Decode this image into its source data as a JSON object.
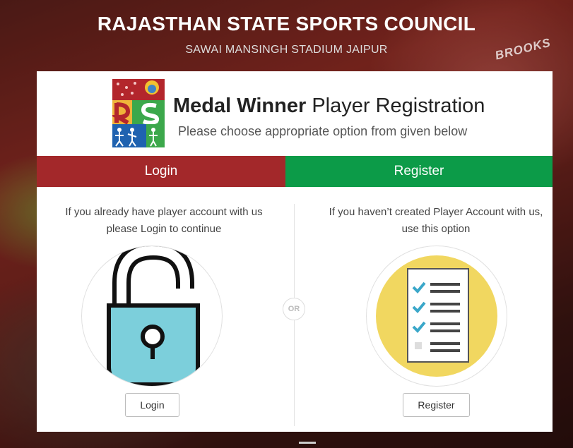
{
  "header": {
    "title": "RAJASTHAN STATE SPORTS COUNCIL",
    "subtitle": "SAWAI MANSINGH STADIUM JAIPUR",
    "background_brand": "BROOKS"
  },
  "card": {
    "title_bold": "Medal Winner",
    "title_rest": " Player Registration",
    "subtitle": "Please choose appropriate option from given below",
    "logo_icon": "rsc-logo-icon"
  },
  "tabs": {
    "login_label": "Login",
    "register_label": "Register"
  },
  "login_panel": {
    "description": "If you already have player account with us please Login to continue",
    "icon": "unlocked-padlock-icon",
    "button_label": "Login"
  },
  "separator": {
    "label": "OR"
  },
  "register_panel": {
    "description": "If you haven’t created Player Account with us, use this option",
    "icon": "checklist-icon",
    "button_label": "Register"
  },
  "colors": {
    "login_tab": "#a3282a",
    "register_tab": "#0c9b48",
    "lock_body": "#7ccfdb",
    "checklist_circle": "#f1d760",
    "check_mark": "#3aa7c9"
  }
}
